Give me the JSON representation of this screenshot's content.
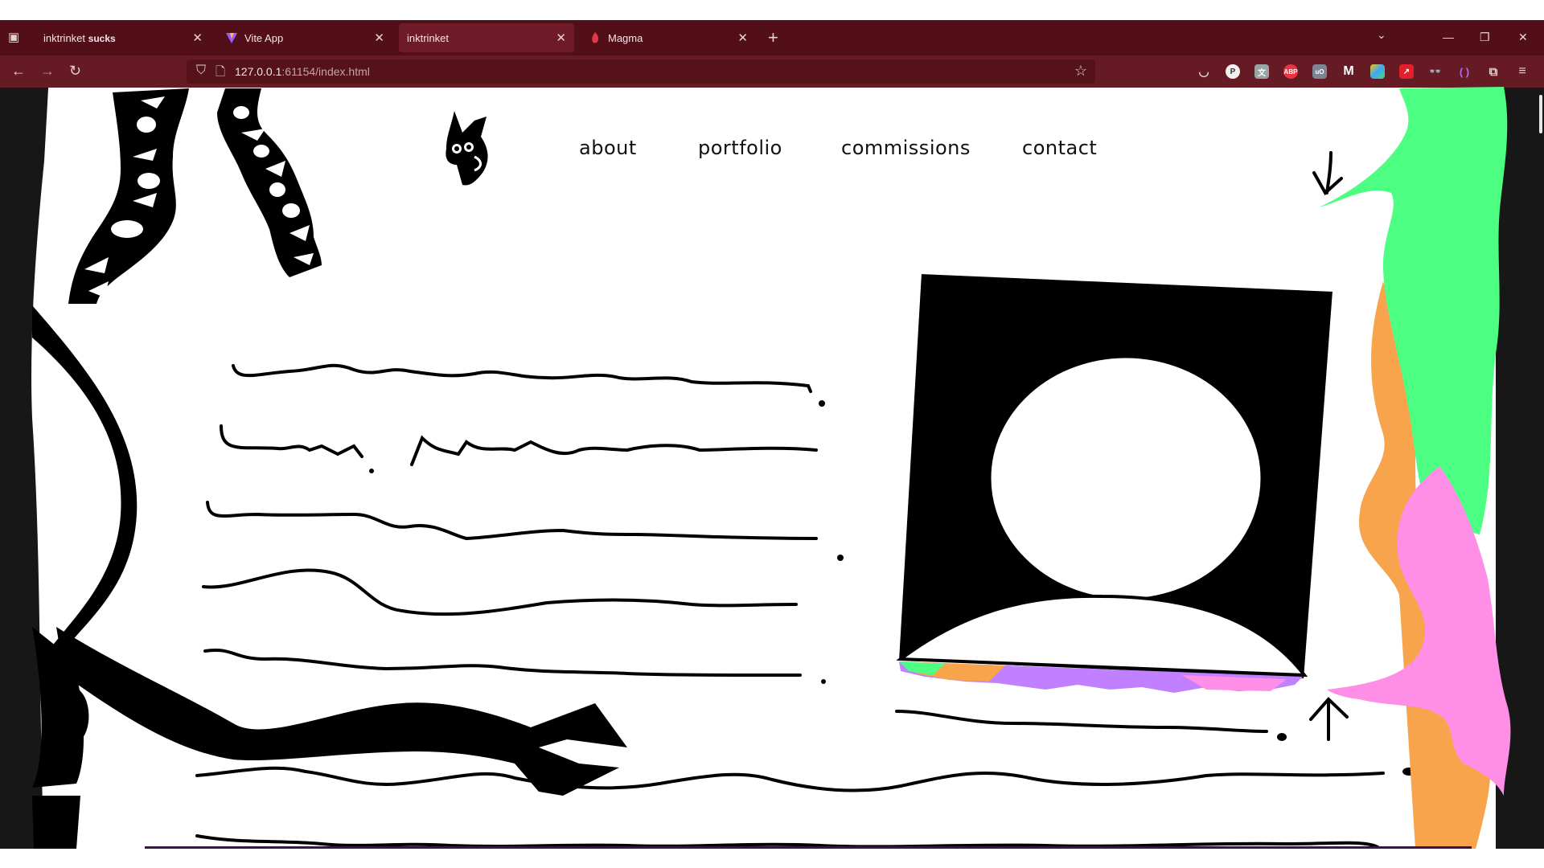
{
  "browser": {
    "tabs": [
      {
        "label": "inktrinket ",
        "label_bold": "sucks",
        "icon": "sidebar-icon"
      },
      {
        "label": "Vite App",
        "icon": "vite-logo-icon"
      },
      {
        "label": "inktrinket",
        "icon": null,
        "active": true
      },
      {
        "label": "Magma",
        "icon": "magma-icon"
      }
    ],
    "url_host": "127.0.0.1",
    "url_rest": ":61154/index.html",
    "colors": {
      "tabbar": "#520f18",
      "toolbar": "#651a24"
    }
  },
  "site": {
    "nav": [
      "about",
      "portfolio",
      "commissions",
      "contact"
    ],
    "colors": {
      "green": "#4cff83",
      "orange": "#f8a44c",
      "pink": "#ff8ee6",
      "purple": "#c080ff",
      "ink": "#000000"
    }
  }
}
